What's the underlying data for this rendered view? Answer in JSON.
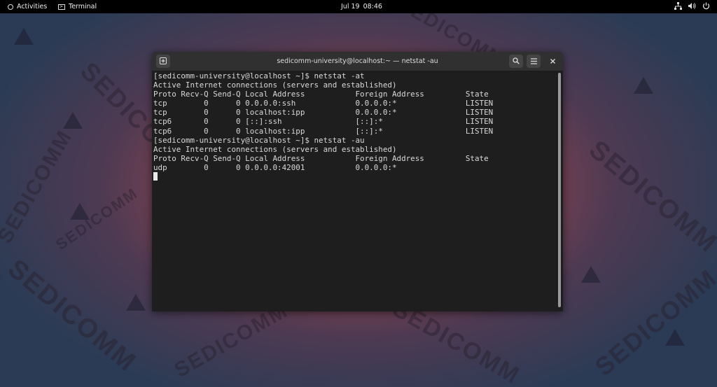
{
  "topbar": {
    "activities": "Activities",
    "app_name": "Terminal",
    "date": "Jul 19",
    "time": "08:46"
  },
  "window": {
    "title": "sedicomm-university@localhost:~ — netstat -au"
  },
  "terminal": {
    "lines": [
      "[sedicomm-university@localhost ~]$ netstat -at",
      "Active Internet connections (servers and established)",
      "Proto Recv-Q Send-Q Local Address           Foreign Address         State",
      "tcp        0      0 0.0.0.0:ssh             0.0.0.0:*               LISTEN",
      "tcp        0      0 localhost:ipp           0.0.0.0:*               LISTEN",
      "tcp6       0      0 [::]:ssh                [::]:*                  LISTEN",
      "tcp6       0      0 localhost:ipp           [::]:*                  LISTEN",
      "[sedicomm-university@localhost ~]$ netstat -au",
      "Active Internet connections (servers and established)",
      "Proto Recv-Q Send-Q Local Address           Foreign Address         State",
      "udp        0      0 0.0.0.0:42001           0.0.0.0:*"
    ]
  },
  "wallpaper": {
    "watermark_text": "SEDICOMM",
    "colors": {
      "center": "#b65a63",
      "edge": "#2b3b55"
    }
  },
  "icons": [
    "activities-icon",
    "terminal-app-icon",
    "network-icon",
    "volume-icon",
    "power-icon",
    "new-tab-icon",
    "search-icon",
    "menu-icon",
    "close-icon"
  ]
}
